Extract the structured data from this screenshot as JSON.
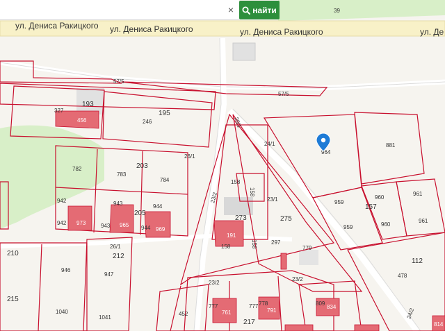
{
  "search": {
    "value": "",
    "placeholder": "",
    "clear_label": "×",
    "button_label": "найти"
  },
  "streets": {
    "label_1": "ул. Дениса Ракицкого",
    "label_2": "ул. Дениса Ракицкого",
    "label_3": "ул. Дениса Ракицкого",
    "label_4": "ул. Де"
  },
  "parcels": {
    "p39": "39",
    "p57_5a": "57/5",
    "p57_5b": "57/5",
    "p193": "193",
    "p195": "195",
    "p327": "327",
    "p456": "456",
    "p246": "246",
    "p26_1a": "26/1",
    "p26_1b": "26/1",
    "p26_1c": "26/1",
    "p24_1": "24/1",
    "p964": "964",
    "p881": "881",
    "p782": "782",
    "p783": "783",
    "p203": "203",
    "p784": "784",
    "p158a": "158",
    "p158b": "158",
    "p158c": "158",
    "p158d": "158",
    "p23_2a": "23/2",
    "p23_2b": "23/2",
    "p23_2c": "23/2",
    "p23_1": "23/1",
    "p942a": "942",
    "p942b": "942",
    "p943a": "943",
    "p943b": "943",
    "p944a": "944",
    "p944b": "944",
    "p205": "205",
    "p973": "973",
    "p965": "965",
    "p969": "969",
    "p273": "273",
    "p275": "275",
    "p191": "191",
    "p297": "297",
    "p779": "779",
    "p959a": "959",
    "p959b": "959",
    "p960a": "960",
    "p960b": "960",
    "p961a": "961",
    "p961b": "961",
    "p157": "157",
    "p210": "210",
    "p212": "212",
    "p946": "946",
    "p947": "947",
    "p215": "215",
    "p1040": "1040",
    "p1041": "1041",
    "p112": "112",
    "p478": "478",
    "p452": "452",
    "p777": "777",
    "p761": "761",
    "p217": "217",
    "p777b": "777",
    "p778": "778",
    "p791": "791",
    "p809": "809",
    "p834": "834",
    "p24_2": "24/2",
    "p814": "814"
  },
  "colors": {
    "boundary": "#c8102e",
    "building": "#e46b74",
    "road": "#ffffff",
    "main_road": "#f8f1c8",
    "greenery": "#d8efc8",
    "pin": "#1e7bd6",
    "search_button": "#2d8f3c"
  },
  "icons": {
    "search": "search-icon",
    "clear": "close-icon",
    "pin": "location-pin-icon"
  }
}
